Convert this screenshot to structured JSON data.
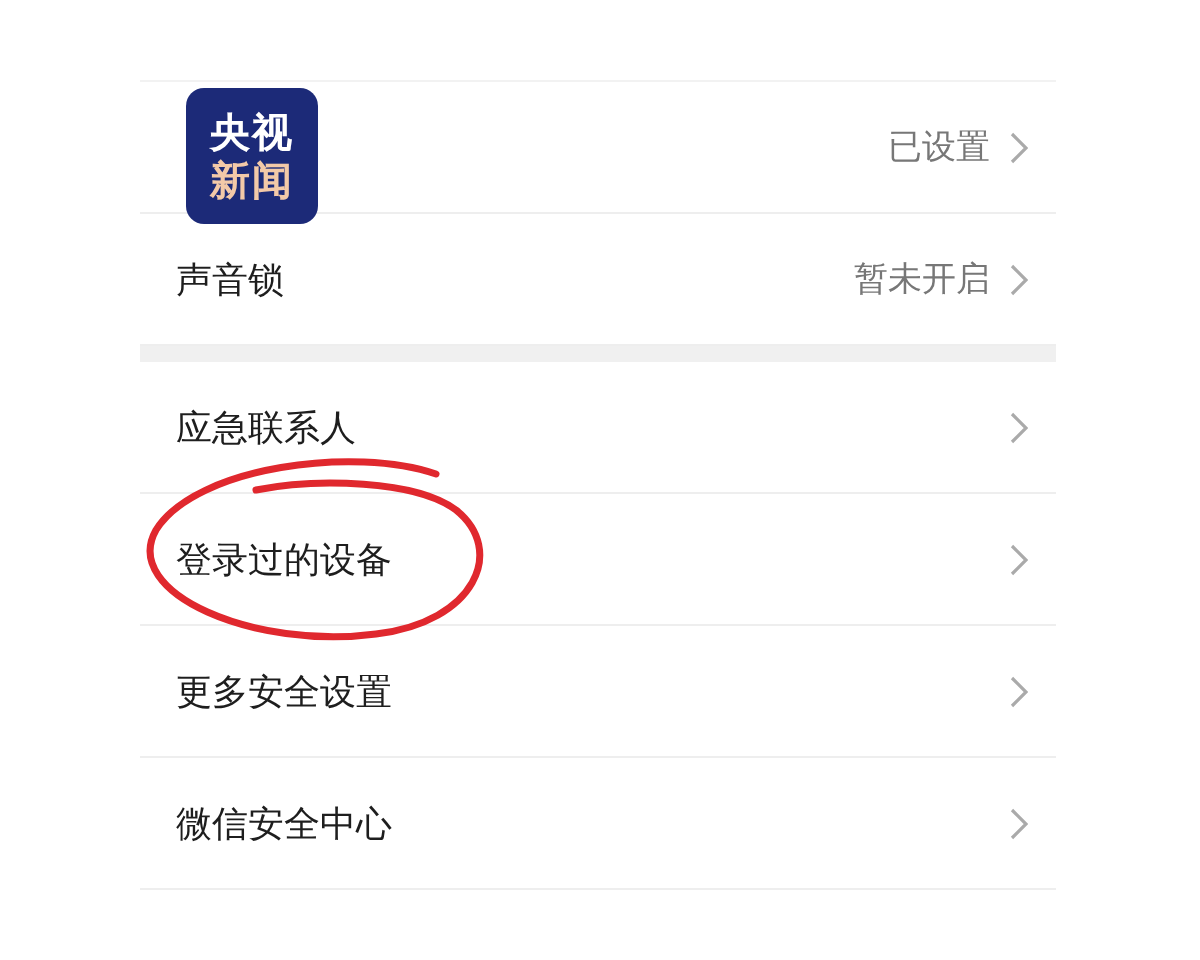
{
  "logo": {
    "top": "央视",
    "bottom": "新闻"
  },
  "groups": [
    {
      "rows": [
        {
          "label": "",
          "value": "已设置"
        },
        {
          "label": "声音锁",
          "value": "暂未开启"
        }
      ]
    },
    {
      "rows": [
        {
          "label": "应急联系人",
          "value": ""
        },
        {
          "label": "登录过的设备",
          "value": "",
          "circled": true
        },
        {
          "label": "更多安全设置",
          "value": ""
        },
        {
          "label": "微信安全中心",
          "value": ""
        }
      ]
    }
  ]
}
